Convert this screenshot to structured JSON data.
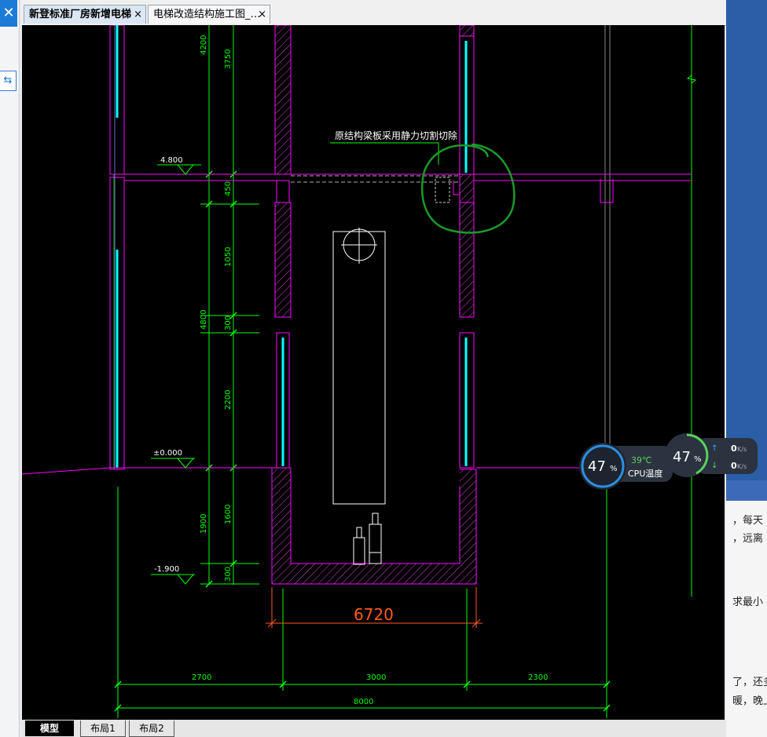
{
  "tabs": [
    {
      "label": "新登标准厂房新增电梯",
      "active": true
    },
    {
      "label": "电梯改造结构施工图_…",
      "active": false
    }
  ],
  "tab_close_glyph": "×",
  "layout_tabs": [
    {
      "label": "模型",
      "active": true
    },
    {
      "label": "布局1",
      "active": false
    },
    {
      "label": "布局2",
      "active": false
    }
  ],
  "drawing": {
    "note": "原结构梁板采用静力切割切除",
    "elev_top": "4.800",
    "elev_ground": "±0.000",
    "elev_pit": "-1.900",
    "dims_left_outer": [
      "4200",
      "4800",
      "1900"
    ],
    "dims_left_inner": [
      "3750",
      "450",
      "1050",
      "300",
      "2200",
      "1600",
      "300"
    ],
    "dim_pit_width": "6720",
    "dims_bottom": [
      "2700",
      "3000",
      "2300"
    ],
    "dim_total": "8000",
    "colors": {
      "background": "#000000",
      "wall": "#ff00ff",
      "dim": "#00ff00",
      "glass": "#00ffff",
      "note_mark": "#1a9a2a",
      "pit_dim": "#ff5a1e"
    }
  },
  "monitor": {
    "cpu_usage": "47",
    "cpu_unit": "%",
    "temp": "39℃",
    "temp_label": "CPU温度",
    "mem_usage": "47",
    "mem_unit": "%",
    "upload": "0",
    "download": "0",
    "speed_unit": "K/s"
  },
  "right_texts": [
    "，每天",
    "，远离",
    "求最小",
    "了，还多",
    "暖，晚上"
  ],
  "left_icons": {
    "close": "✕",
    "sync": "⇆"
  }
}
